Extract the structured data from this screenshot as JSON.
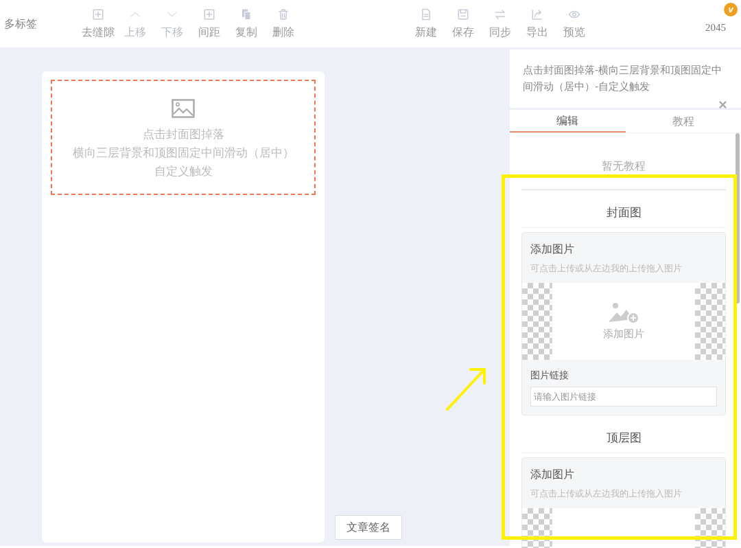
{
  "header": {
    "title": "多标签",
    "count": "2045",
    "badge": "v"
  },
  "toolbar_left": [
    {
      "label": "去缝隙",
      "disabled": false
    },
    {
      "label": "上移",
      "disabled": true
    },
    {
      "label": "下移",
      "disabled": true
    },
    {
      "label": "间距",
      "disabled": false
    },
    {
      "label": "复制",
      "disabled": false
    },
    {
      "label": "删除",
      "disabled": false
    }
  ],
  "toolbar_right": [
    {
      "label": "新建",
      "disabled": false
    },
    {
      "label": "保存",
      "disabled": false
    },
    {
      "label": "同步",
      "disabled": false
    },
    {
      "label": "导出",
      "disabled": false
    },
    {
      "label": "预览",
      "disabled": false
    }
  ],
  "canvas": {
    "placeholder_lines": [
      "点击封面图掉落",
      "横向三层背景和顶图固定中间滑动（居中）",
      "自定义触发"
    ],
    "signature_button": "文章签名"
  },
  "panel": {
    "title": "点击封面图掉落-横向三层背景和顶图固定中间滑动（居中）-自定义触发",
    "tabs": [
      {
        "label": "编辑",
        "selected": true
      },
      {
        "label": "教程",
        "selected": false
      }
    ],
    "empty_text": "暂无教程",
    "sections": [
      {
        "heading": "封面图",
        "card_title": "添加图片",
        "hint": "可点击上传或从左边我的上传拖入图片",
        "upload_label": "添加图片",
        "link_label": "图片链接",
        "link_placeholder": "请输入图片链接"
      },
      {
        "heading": "顶层图",
        "card_title": "添加图片",
        "hint": "可点击上传或从左边我的上传拖入图片"
      }
    ]
  }
}
